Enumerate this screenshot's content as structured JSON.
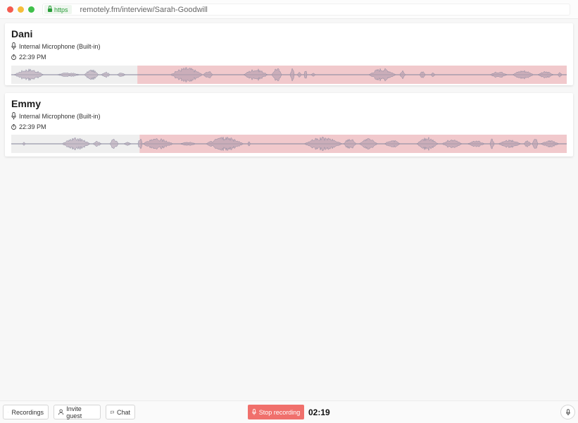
{
  "browser": {
    "security_label": "https",
    "url": "remotely.fm/interview/Sarah-Goodwill"
  },
  "participants": [
    {
      "name": "Dani",
      "device": "Internal Microphone (Built-in)",
      "time": "22:39 PM",
      "recorded_fraction": 0.773
    },
    {
      "name": "Emmy",
      "device": "Internal Microphone (Built-in)",
      "time": "22:39 PM",
      "recorded_fraction": 0.769
    }
  ],
  "footer": {
    "recordings_label": "Recordings",
    "invite_label": "Invite guest",
    "chat_label": "Chat",
    "stop_label": "Stop recording",
    "timer": "02:19"
  },
  "colors": {
    "recorded_fill": "#f1c9cc",
    "unrecorded_fill": "#efefef",
    "wave_stroke": "#8a8aa0",
    "stop_button": "#f0706c"
  }
}
